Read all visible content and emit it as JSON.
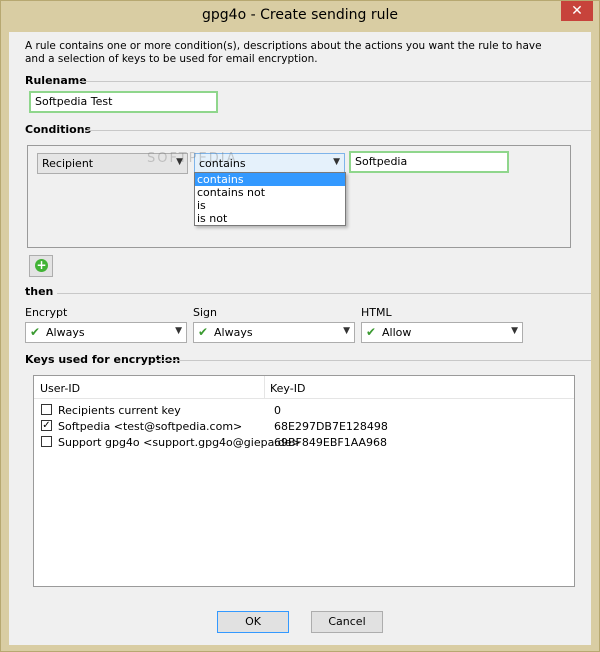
{
  "window": {
    "title": "gpg4o - Create sending rule",
    "close_label": "✕"
  },
  "description": "A rule contains one or more condition(s), descriptions about the actions you want the rule to have and a selection of keys to be used for email encryption.",
  "rulename": {
    "heading": "Rulename",
    "value": "Softpedia Test"
  },
  "conditions": {
    "heading": "Conditions",
    "field_combo": "Recipient",
    "operator_combo": "contains",
    "value": "Softpedia",
    "operator_options": [
      "contains",
      "contains not",
      "is",
      "is not"
    ],
    "watermark": "SOFTPEDIA"
  },
  "then": {
    "heading": "then",
    "encrypt": {
      "label": "Encrypt",
      "value": "Always"
    },
    "sign": {
      "label": "Sign",
      "value": "Always"
    },
    "html": {
      "label": "HTML",
      "value": "Allow"
    }
  },
  "keys": {
    "heading": "Keys used for encryption",
    "columns": [
      "User-ID",
      "Key-ID"
    ],
    "rows": [
      {
        "checked": false,
        "user_id": "Recipients current key",
        "key_id": "0"
      },
      {
        "checked": true,
        "user_id": "Softpedia <test@softpedia.com>",
        "key_id": "68E297DB7E128498"
      },
      {
        "checked": false,
        "user_id": "Support gpg4o <support.gpg4o@giepa.de>",
        "key_id": "69BF849EBF1AA968"
      }
    ]
  },
  "buttons": {
    "ok": "OK",
    "cancel": "Cancel"
  },
  "icons": {
    "add": "add-icon",
    "check": "check-icon",
    "dropdown": "chevron-down-icon"
  },
  "colors": {
    "titlebar": "#d9cda3",
    "close": "#c7433b",
    "accent_green": "#41b335",
    "selection": "#3399ff"
  }
}
